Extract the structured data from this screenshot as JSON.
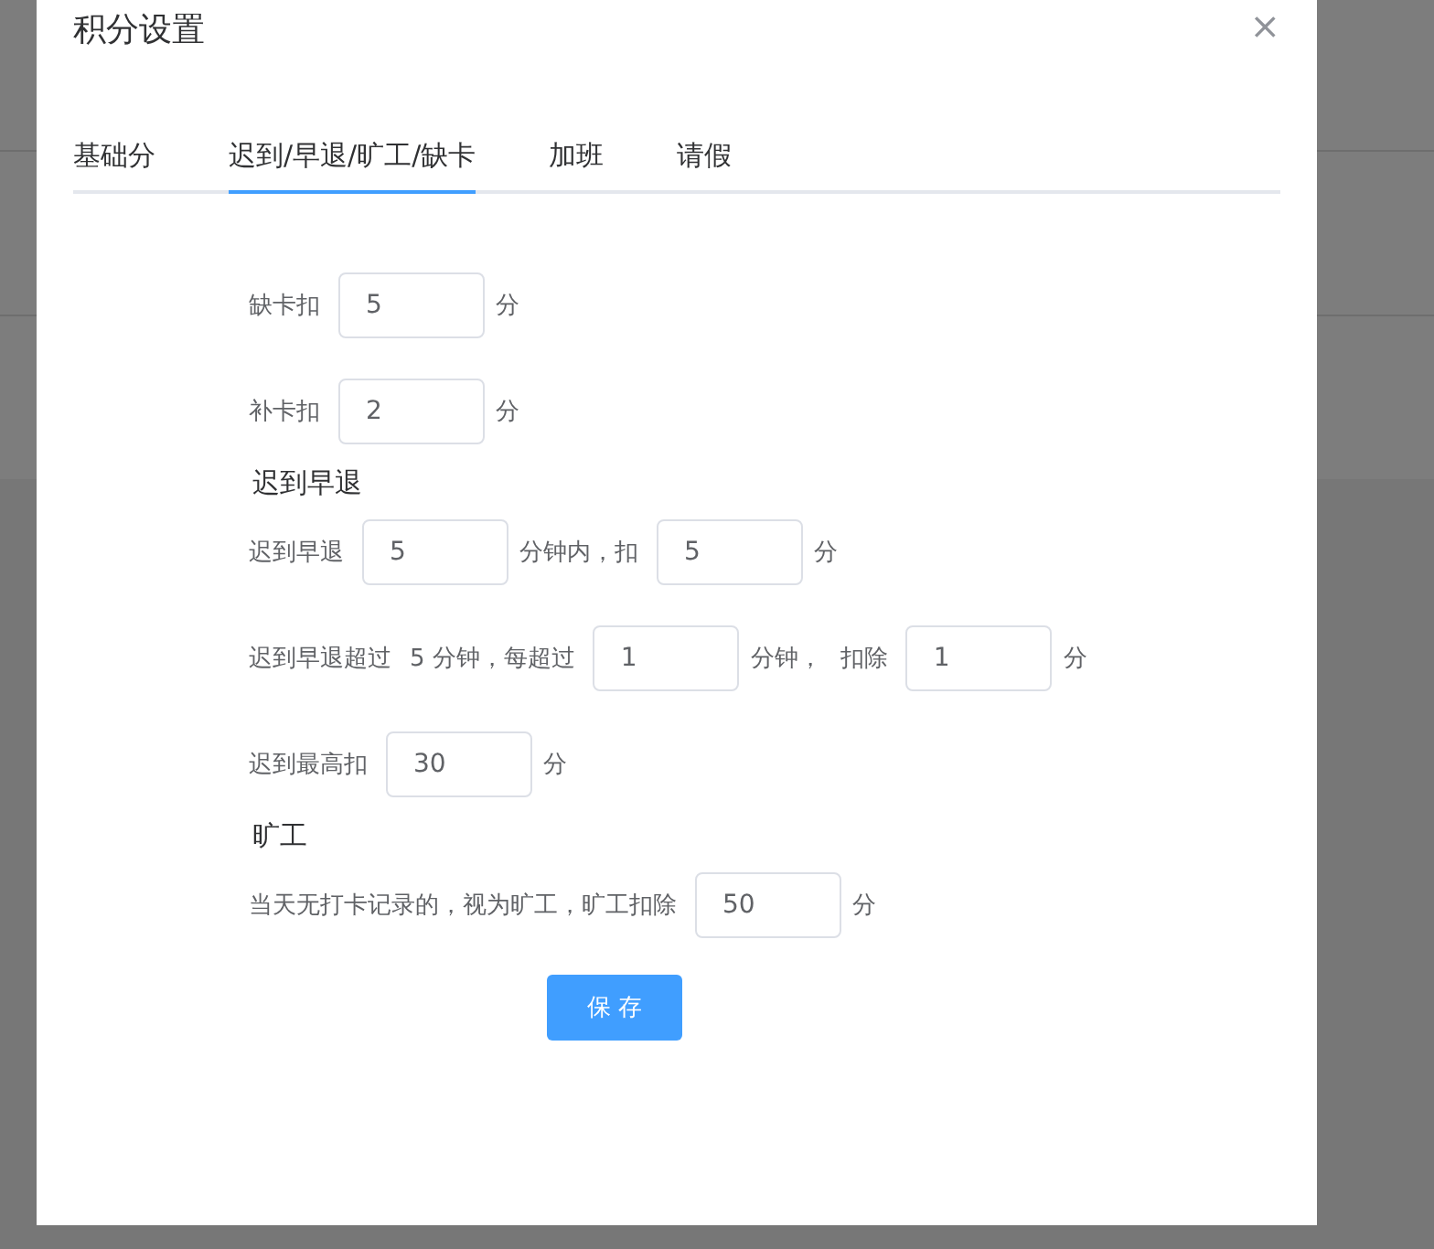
{
  "dialog": {
    "title": "积分设置",
    "close": "×"
  },
  "tabs": [
    {
      "label": "基础分",
      "selected": false
    },
    {
      "label": "迟到/早退/旷工/缺卡",
      "selected": true
    },
    {
      "label": "加班",
      "selected": false
    },
    {
      "label": "请假",
      "selected": false
    }
  ],
  "form": [
    {
      "kind": "row",
      "items": [
        {
          "kind": "text",
          "text": "缺卡扣"
        },
        {
          "kind": "input",
          "value": "5"
        },
        {
          "kind": "text",
          "text": "分"
        }
      ]
    },
    {
      "kind": "row",
      "items": [
        {
          "kind": "text",
          "text": "补卡扣"
        },
        {
          "kind": "input",
          "value": "2"
        },
        {
          "kind": "text",
          "text": "分"
        }
      ]
    },
    {
      "kind": "heading",
      "text": "迟到早退"
    },
    {
      "kind": "row",
      "items": [
        {
          "kind": "text",
          "text": "迟到早退"
        },
        {
          "kind": "input",
          "value": "5"
        },
        {
          "kind": "text",
          "text": "分钟内，扣"
        },
        {
          "kind": "input",
          "value": "5"
        },
        {
          "kind": "text",
          "text": "分"
        }
      ]
    },
    {
      "kind": "row",
      "items": [
        {
          "kind": "text",
          "text": "迟到早退超过"
        },
        {
          "kind": "text",
          "text": "5 分钟，每超过"
        },
        {
          "kind": "input",
          "value": "1"
        },
        {
          "kind": "text",
          "text": "分钟，"
        },
        {
          "kind": "text",
          "text": "扣除"
        },
        {
          "kind": "input",
          "value": "1"
        },
        {
          "kind": "text",
          "text": "分"
        }
      ]
    },
    {
      "kind": "row",
      "items": [
        {
          "kind": "text",
          "text": "迟到最高扣"
        },
        {
          "kind": "input",
          "value": "30"
        },
        {
          "kind": "text",
          "text": "分"
        }
      ]
    },
    {
      "kind": "heading",
      "text": "旷工"
    },
    {
      "kind": "row",
      "items": [
        {
          "kind": "text",
          "text": "当天无打卡记录的，视为旷工，旷工扣除"
        },
        {
          "kind": "input",
          "value": "50"
        },
        {
          "kind": "text",
          "text": "分"
        }
      ]
    }
  ],
  "save_button": "保 存"
}
